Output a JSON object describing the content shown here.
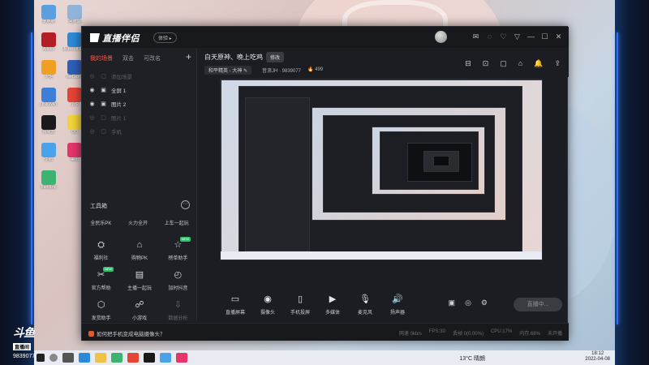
{
  "app": {
    "logo": "直播伴侣",
    "version_badge": "体验",
    "window_controls": [
      "✉",
      "◌",
      "♡",
      "▽",
      "—",
      "☐",
      "✕"
    ]
  },
  "scenes": {
    "tabs": [
      {
        "label": "我的场景",
        "active": true
      },
      {
        "label": "双击",
        "active": false
      },
      {
        "label": "可改名",
        "active": false
      }
    ],
    "add_label": "+",
    "items": [
      {
        "label": "添加场景",
        "visible": false,
        "locked": false
      },
      {
        "label": "全屏 1",
        "visible": true,
        "locked": true
      },
      {
        "label": "图片 2",
        "visible": true,
        "locked": true
      },
      {
        "label": "图片 1",
        "visible": false,
        "locked": false
      },
      {
        "label": "手机",
        "visible": false,
        "locked": false
      }
    ]
  },
  "toolbox": {
    "title": "工具箱",
    "more": "⋯",
    "text_row": [
      "全民乐PK",
      "火力全开",
      "上车一起玩"
    ],
    "tools": [
      {
        "label": "福利社",
        "icon": "gift-box-icon",
        "glyph": "⛭",
        "badge": ""
      },
      {
        "label": "购物PK",
        "icon": "shop-icon",
        "glyph": "⌂",
        "badge": ""
      },
      {
        "label": "榜单助手",
        "icon": "star-board-icon",
        "glyph": "☆",
        "badge": "NEW"
      },
      {
        "label": "官方帮助",
        "icon": "scissors-icon",
        "glyph": "✂",
        "badge": "NEW"
      },
      {
        "label": "主播一起玩",
        "icon": "clipboard-icon",
        "glyph": "▤",
        "badge": ""
      },
      {
        "label": "加时抖音",
        "icon": "timer-icon",
        "glyph": "◴",
        "badge": ""
      },
      {
        "label": "发货助手",
        "icon": "box-icon",
        "glyph": "⬡",
        "badge": ""
      },
      {
        "label": "小游戏",
        "icon": "gamepad-icon",
        "glyph": "☍",
        "badge": ""
      },
      {
        "label": "数据分析",
        "icon": "download-icon",
        "glyph": "⇩",
        "badge": "",
        "dim": true
      }
    ]
  },
  "room": {
    "title": "白天原神、晚上吃鸡",
    "edit": "修改",
    "category": "和平精英 - 大神 ✎",
    "id": "音浪JH · 9839077",
    "heat": "🔥 499"
  },
  "head_icons": [
    "⊟",
    "⊡",
    "▢",
    "⌂",
    "🔔",
    "⇪"
  ],
  "controls": [
    {
      "label": "直播屏幕",
      "icon": "screen-icon",
      "glyph": "▭"
    },
    {
      "label": "摄像头",
      "icon": "camera-icon",
      "glyph": "◉"
    },
    {
      "label": "手机投屏",
      "icon": "phone-cast-icon",
      "glyph": "▯"
    },
    {
      "label": "多媒体",
      "icon": "media-icon",
      "glyph": "▶"
    },
    {
      "label": "麦克风",
      "icon": "microphone-icon",
      "glyph": "🎙"
    },
    {
      "label": "扬声器",
      "icon": "speaker-icon",
      "glyph": "🔊"
    }
  ],
  "right_controls": [
    "▣",
    "◎",
    "⚙"
  ],
  "live_button": "直播中...",
  "status": {
    "help": "如何把手机变成电脑摄像头？",
    "items": [
      "网速 0kb/s",
      "FPS:30",
      "丢帧 0(0.00%)",
      "CPU:17%",
      "内存:68%",
      "未开播"
    ]
  },
  "taskbar": {
    "weather": "13°C 晴朗",
    "time": "18:12",
    "date": "2022-04-08"
  },
  "watermark": {
    "logo": "斗鱼",
    "sub": "直播间",
    "id": "9839077"
  },
  "desktop_icons": [
    {
      "label": "此电脑",
      "color": "#5aa0e0"
    },
    {
      "label": "回收站",
      "color": "#8fb3d9"
    },
    {
      "label": "Adobe",
      "color": "#b51e24"
    },
    {
      "label": "Microsoft Edge",
      "color": "#2c8bd8"
    },
    {
      "label": "火炬",
      "color": "#f0a020"
    },
    {
      "label": "WeGame",
      "color": "#2f5fb8"
    },
    {
      "label": "LINKWAY",
      "color": "#3d7fd6"
    },
    {
      "label": "小说",
      "color": "#e64437"
    },
    {
      "label": "网易云",
      "color": "#1a1a1a"
    },
    {
      "label": "QQ",
      "color": "#f2d43a"
    },
    {
      "label": "企鹅",
      "color": "#4aa3e8"
    },
    {
      "label": "美图",
      "color": "#e7356b"
    },
    {
      "label": "Bandizip",
      "color": "#3cb371"
    }
  ]
}
